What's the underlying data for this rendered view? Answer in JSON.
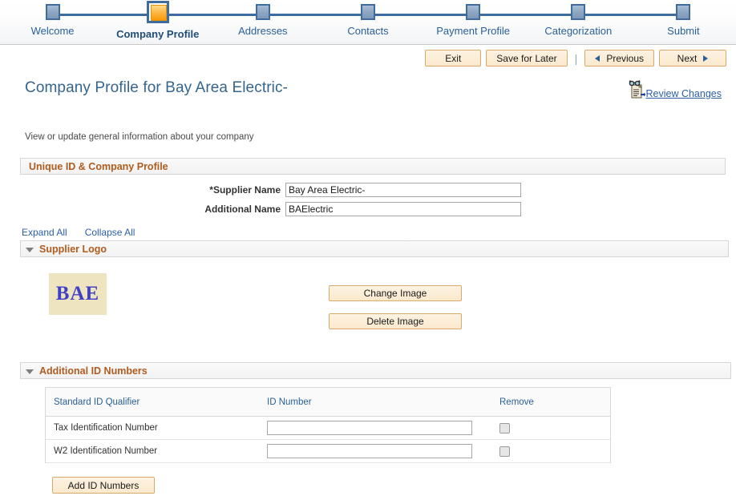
{
  "wizard": {
    "steps": [
      {
        "label": "Welcome",
        "active": false
      },
      {
        "label": "Company Profile",
        "active": true
      },
      {
        "label": "Addresses",
        "active": false
      },
      {
        "label": "Contacts",
        "active": false
      },
      {
        "label": "Payment Profile",
        "active": false
      },
      {
        "label": "Categorization",
        "active": false
      },
      {
        "label": "Submit",
        "active": false
      }
    ]
  },
  "toolbar": {
    "exit_label": "Exit",
    "save_label": "Save for Later",
    "separator": "|",
    "previous_label": "Previous",
    "next_label": "Next"
  },
  "header": {
    "page_title": "Company Profile for Bay Area Electric-",
    "review_changes_label": "Review Changes",
    "review_icon": "glasses-document-icon"
  },
  "main": {
    "intro_text": "View or update general information about your company",
    "sections": {
      "unique_id": {
        "title": "Unique ID & Company Profile",
        "fields": [
          {
            "label": "*Supplier Name",
            "value": "Bay Area Electric-",
            "placeholder": ""
          },
          {
            "label": "Additional Name",
            "value": "BAElectric",
            "placeholder": ""
          }
        ]
      },
      "expand_all_label": "Expand All",
      "collapse_all_label": "Collapse All",
      "supplier_logo": {
        "title": "Supplier Logo",
        "logo_text": "BAE",
        "change_image_label": "Change Image",
        "delete_image_label": "Delete Image"
      },
      "additional_ids": {
        "title": "Additional ID Numbers",
        "columns": [
          "Standard ID Qualifier",
          "ID Number",
          "Remove"
        ],
        "rows": [
          {
            "qualifier": "Tax Identification Number",
            "id_number": "",
            "remove_checked": false
          },
          {
            "qualifier": "W2 Identification Number",
            "id_number": "",
            "remove_checked": false
          }
        ],
        "add_button_label": "Add ID Numbers"
      }
    }
  },
  "colors": {
    "accent_blue": "#2a6099",
    "section_orange": "#b15b1e",
    "button_tan": "#fbe9cd",
    "active_step_orange": "#f79a09",
    "logo_blue": "#3f3fc8",
    "logo_bg": "#eee5c0"
  }
}
